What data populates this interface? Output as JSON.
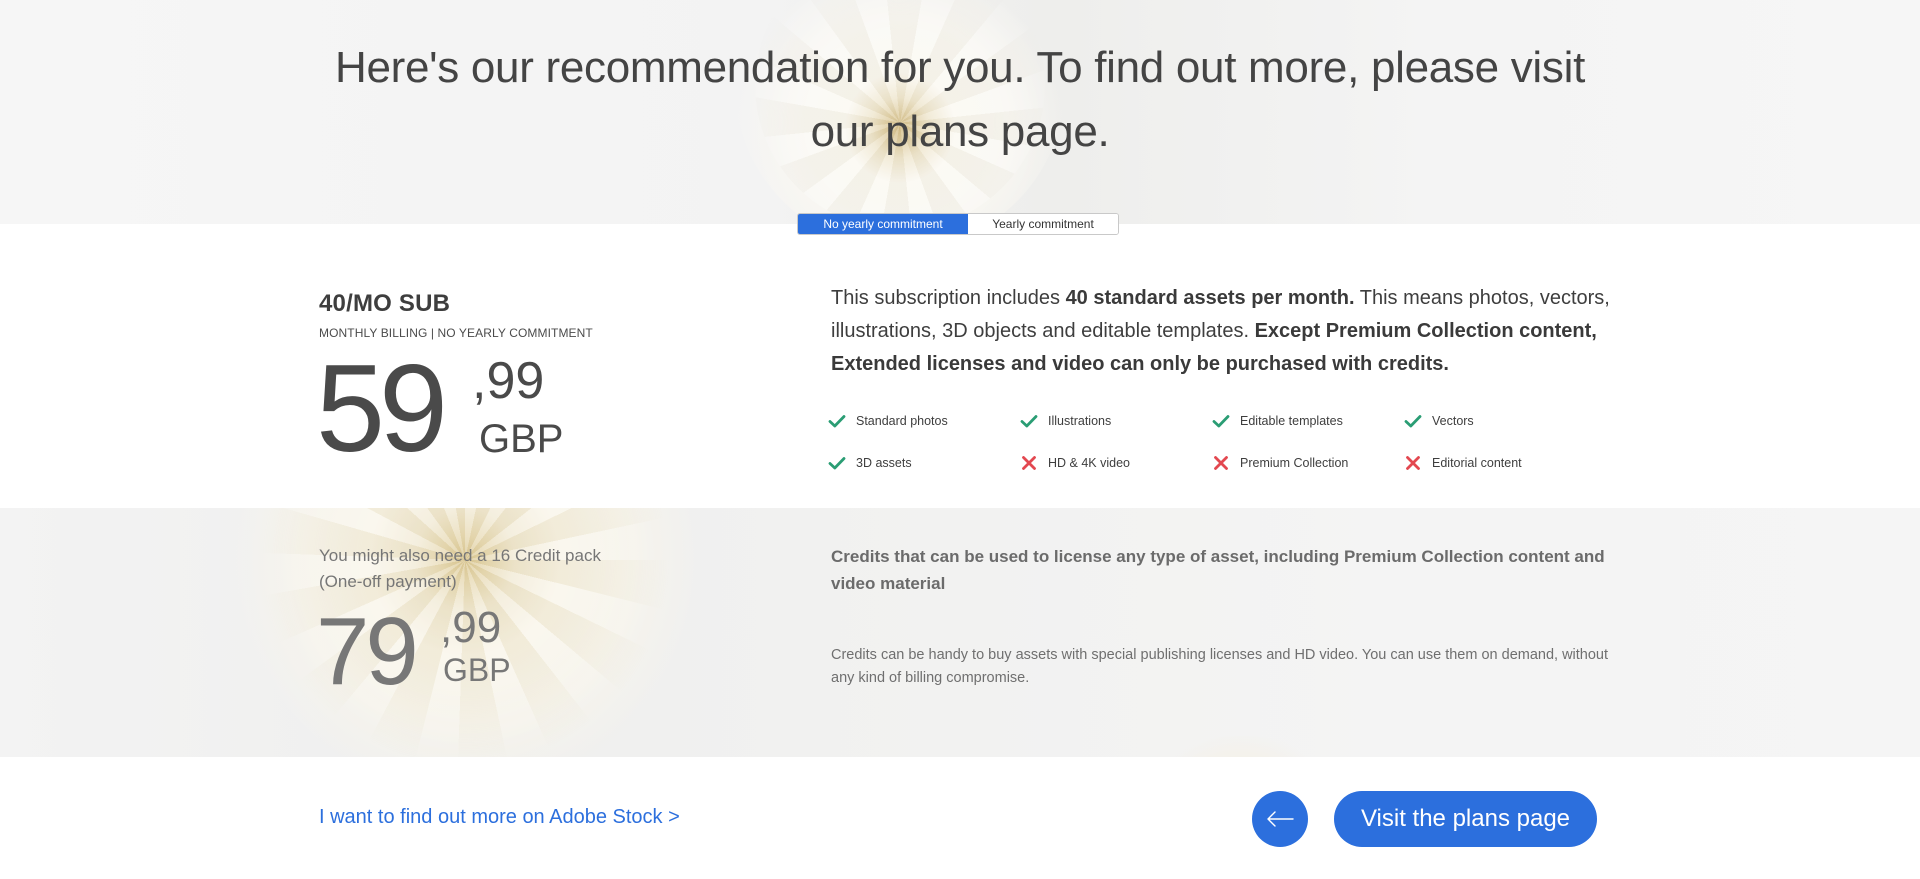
{
  "hero": {
    "title": "Here's our recommendation for you. To find out more, please visit our plans page."
  },
  "toggle": {
    "options": [
      {
        "label": "No yearly commitment",
        "active": true
      },
      {
        "label": "Yearly commitment",
        "active": false
      }
    ]
  },
  "plan": {
    "name": "40/MO SUB",
    "billing": "MONTHLY BILLING | NO YEARLY COMMITMENT",
    "price": {
      "whole": "59",
      "cents": ",99",
      "currency": "GBP"
    },
    "description": {
      "t1": "This subscription includes ",
      "b1": "40 standard assets per month.",
      "t2": " This means photos, vectors, illustrations, 3D objects and editable templates. ",
      "b2": "Except Premium Collection content, Extended licenses and video can only be purchased with credits."
    },
    "features": [
      {
        "label": "Standard photos",
        "included": true,
        "icon": "check-icon"
      },
      {
        "label": "Illustrations",
        "included": true,
        "icon": "check-icon"
      },
      {
        "label": "Editable templates",
        "included": true,
        "icon": "check-icon"
      },
      {
        "label": "Vectors",
        "included": true,
        "icon": "check-icon"
      },
      {
        "label": "3D assets",
        "included": true,
        "icon": "check-icon"
      },
      {
        "label": "HD & 4K video",
        "included": false,
        "icon": "cross-icon"
      },
      {
        "label": "Premium Collection",
        "included": false,
        "icon": "cross-icon"
      },
      {
        "label": "Editorial content",
        "included": false,
        "icon": "cross-icon"
      }
    ]
  },
  "credits": {
    "title": "You might also need a 16 Credit pack (One-off payment)",
    "price": {
      "whole": "79",
      "cents": ",99",
      "currency": "GBP"
    },
    "heading": "Credits that can be used to license any type of asset, including Premium Collection content and video material",
    "body": "Credits can be handy to buy assets with special publishing licenses and HD video. You can use them on demand, without any kind of billing compromise."
  },
  "footer": {
    "more_link": "I want to find out more on Adobe Stock >",
    "back_icon": "arrow-left-icon",
    "visit_button": "Visit the plans page"
  },
  "colors": {
    "accent": "#2c6fdd",
    "check": "#2a9d74",
    "cross": "#e34850"
  }
}
